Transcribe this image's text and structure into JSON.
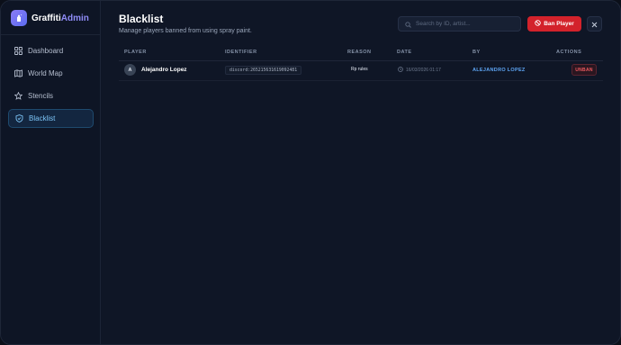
{
  "brand": {
    "name_main": "Graffiti",
    "name_accent": "Admin"
  },
  "sidebar": {
    "items": [
      {
        "label": "Dashboard",
        "icon": "grid-icon",
        "active": false
      },
      {
        "label": "World Map",
        "icon": "map-icon",
        "active": false
      },
      {
        "label": "Stencils",
        "icon": "star-icon",
        "active": false
      },
      {
        "label": "Blacklist",
        "icon": "shield-icon",
        "active": true
      }
    ]
  },
  "header": {
    "title": "Blacklist",
    "subtitle": "Manage players banned from using spray paint.",
    "search_placeholder": "Search by ID, artist...",
    "ban_button_label": "Ban Player"
  },
  "table": {
    "columns": [
      "PLAYER",
      "IDENTIFIER",
      "REASON",
      "DATE",
      "BY",
      "ACTIONS"
    ],
    "rows": [
      {
        "avatar_initial": "A",
        "player": "Alejandro Lopez",
        "identifier": "discord:265215631619092481",
        "reason": "Rp rules",
        "date": "16/03/2026 01:17",
        "by": "ALEJANDRO LOPEZ",
        "action_label": "UNBAN"
      }
    ]
  },
  "colors": {
    "background": "#0f1626",
    "accent_blue": "#7cc4f6",
    "danger": "#d3222b",
    "by_link": "#5ea6f5",
    "brand_accent": "#8f8cf7"
  }
}
